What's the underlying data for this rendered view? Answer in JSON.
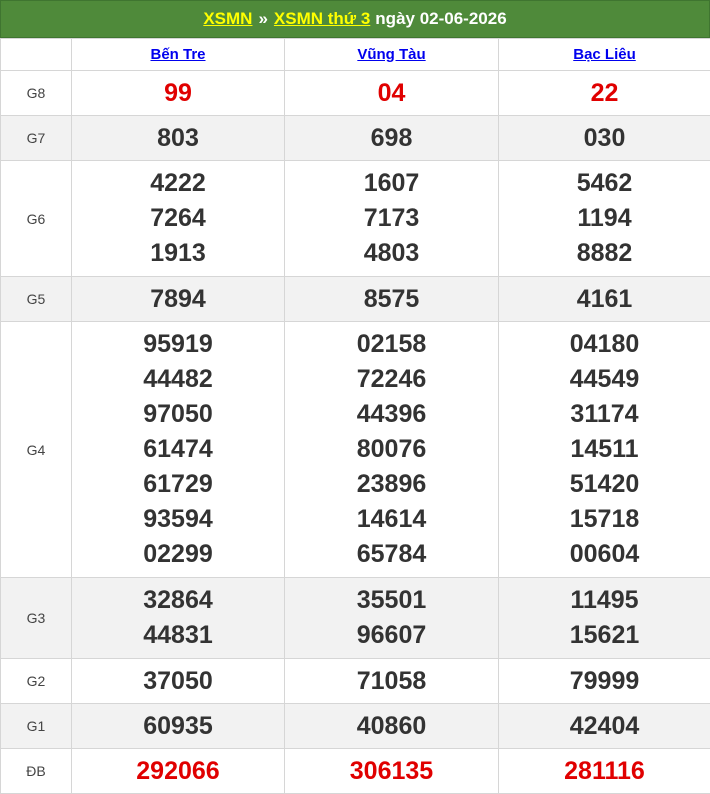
{
  "header": {
    "link1": "XSMN",
    "separator": "»",
    "link2": "XSMN thứ 3",
    "date_text": "ngày 02-06-2026"
  },
  "columns": [
    "Bến Tre",
    "Vũng Tàu",
    "Bạc Liêu"
  ],
  "rows": [
    {
      "label": "G8",
      "highlight": true,
      "values": [
        [
          "99"
        ],
        [
          "04"
        ],
        [
          "22"
        ]
      ]
    },
    {
      "label": "G7",
      "highlight": false,
      "values": [
        [
          "803"
        ],
        [
          "698"
        ],
        [
          "030"
        ]
      ]
    },
    {
      "label": "G6",
      "highlight": false,
      "values": [
        [
          "4222",
          "7264",
          "1913"
        ],
        [
          "1607",
          "7173",
          "4803"
        ],
        [
          "5462",
          "1194",
          "8882"
        ]
      ]
    },
    {
      "label": "G5",
      "highlight": false,
      "values": [
        [
          "7894"
        ],
        [
          "8575"
        ],
        [
          "4161"
        ]
      ]
    },
    {
      "label": "G4",
      "highlight": false,
      "values": [
        [
          "95919",
          "44482",
          "97050",
          "61474",
          "61729",
          "93594",
          "02299"
        ],
        [
          "02158",
          "72246",
          "44396",
          "80076",
          "23896",
          "14614",
          "65784"
        ],
        [
          "04180",
          "44549",
          "31174",
          "14511",
          "51420",
          "15718",
          "00604"
        ]
      ]
    },
    {
      "label": "G3",
      "highlight": false,
      "values": [
        [
          "32864",
          "44831"
        ],
        [
          "35501",
          "96607"
        ],
        [
          "11495",
          "15621"
        ]
      ]
    },
    {
      "label": "G2",
      "highlight": false,
      "values": [
        [
          "37050"
        ],
        [
          "71058"
        ],
        [
          "79999"
        ]
      ]
    },
    {
      "label": "G1",
      "highlight": false,
      "values": [
        [
          "60935"
        ],
        [
          "40860"
        ],
        [
          "42404"
        ]
      ]
    },
    {
      "label": "ĐB",
      "highlight": true,
      "values": [
        [
          "292066"
        ],
        [
          "306135"
        ],
        [
          "281116"
        ]
      ]
    }
  ],
  "colors": {
    "header_bg": "#4f8a3a",
    "header_link": "#ffff00",
    "highlight_number": "#e00000",
    "column_link": "#0000ee",
    "alt_row_bg": "#f2f2f2"
  }
}
